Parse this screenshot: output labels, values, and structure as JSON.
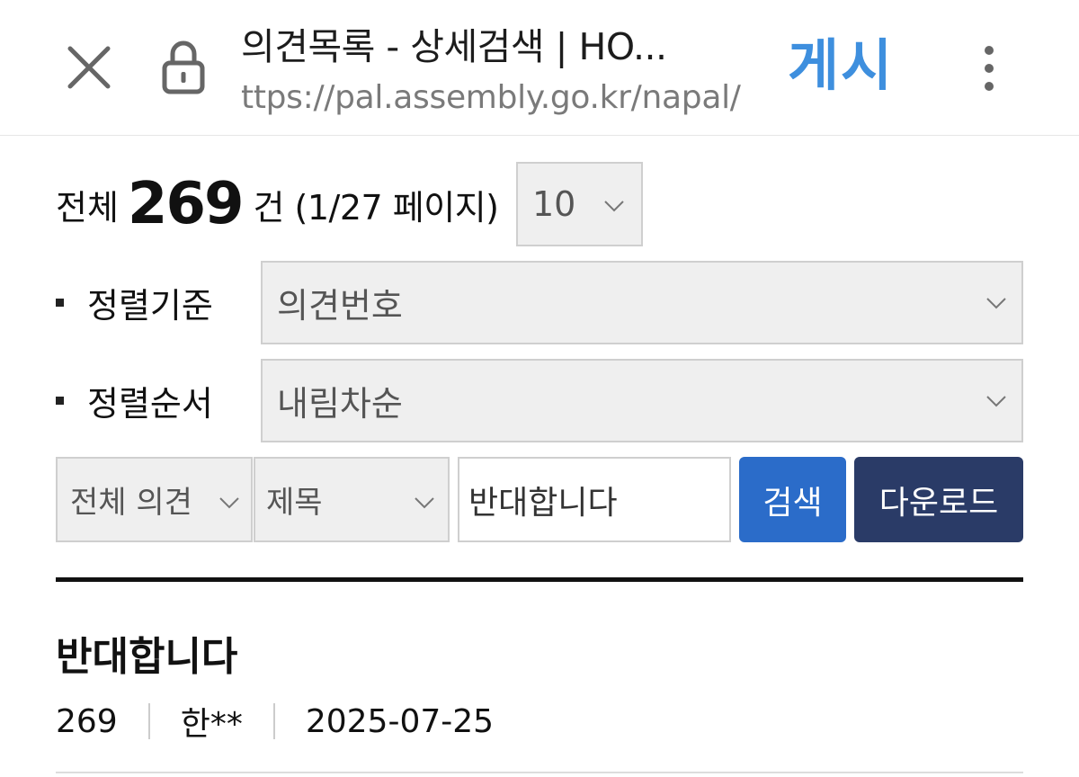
{
  "browser": {
    "page_title": "의견목록 - 상세검색 | HO...",
    "url": "ttps://pal.assembly.go.kr/napal/",
    "post_label": "게시"
  },
  "results": {
    "prefix": "전체",
    "total": "269",
    "suffix": "건 (1/27 페이지)",
    "page_size": "10"
  },
  "sort": {
    "criteria_label": "정렬기준",
    "criteria_value": "의견번호",
    "order_label": "정렬순서",
    "order_value": "내림차순"
  },
  "search": {
    "scope_value": "전체 의견",
    "field_value": "제목",
    "query_value": "반대합니다",
    "search_label": "검색",
    "download_label": "다운로드"
  },
  "items": [
    {
      "title": "반대합니다",
      "number": "269",
      "author": "한**",
      "date": "2025-07-25"
    }
  ],
  "colors": {
    "post_accent": "#3e8fde",
    "search_button": "#2b6cc9",
    "download_button": "#2a3b67"
  }
}
